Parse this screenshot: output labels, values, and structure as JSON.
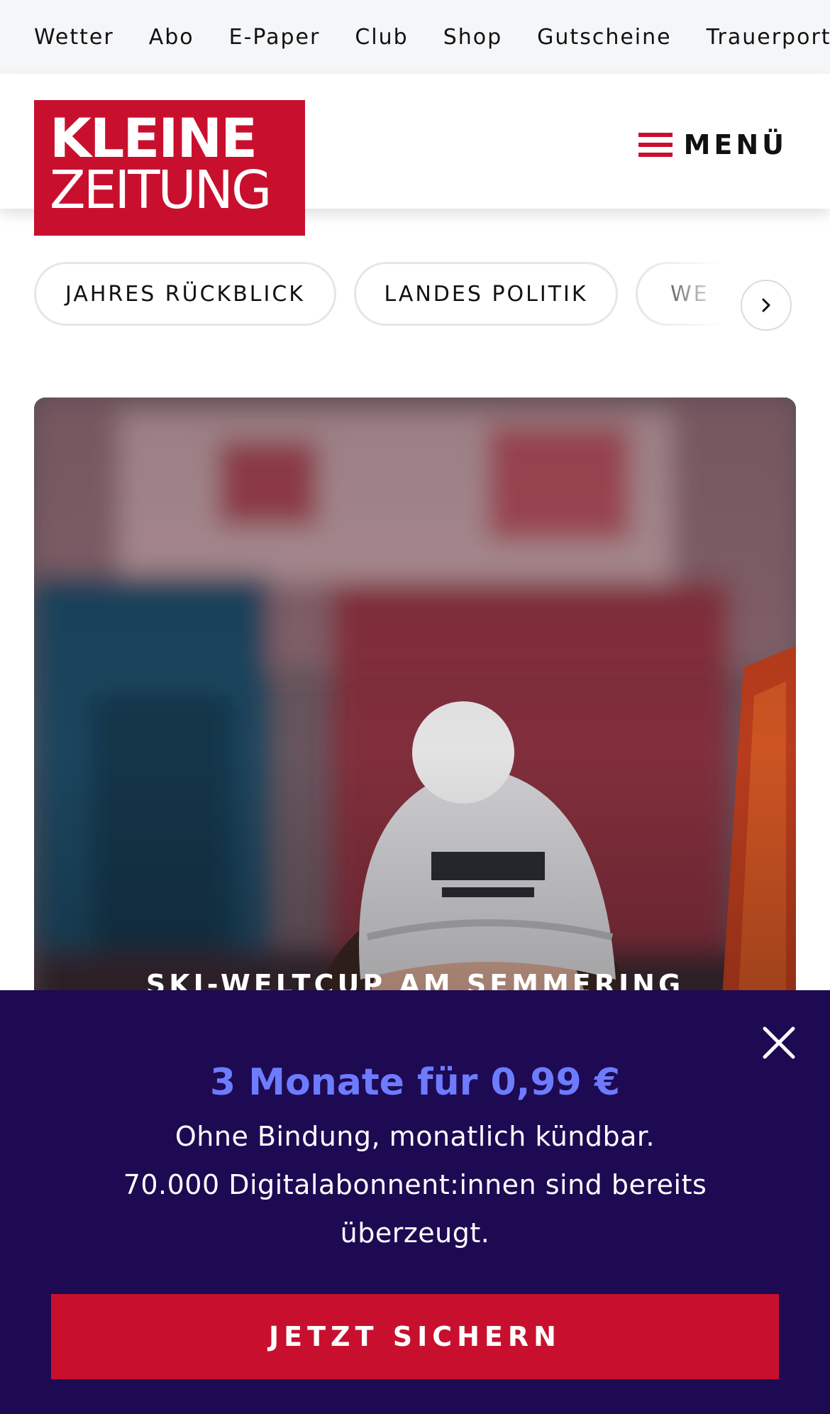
{
  "utility_nav": {
    "items": [
      "Wetter",
      "Abo",
      "E-Paper",
      "Club",
      "Shop",
      "Gutscheine",
      "Trauerportal"
    ]
  },
  "header": {
    "logo_line1": "KLEINE",
    "logo_line2": "ZEITUNG",
    "menu_label": "MENÜ",
    "brand_color": "#c8102e"
  },
  "topics": {
    "items": [
      "JAHRES RÜCKBLICK",
      "LANDES POLITIK",
      "WE"
    ],
    "next_icon": "chevron-right-icon"
  },
  "hero": {
    "kicker": "SKI-WELTCUP AM SEMMERING"
  },
  "promo": {
    "headline": "3 Monate für 0,99 €",
    "line1": "Ohne Bindung, monatlich kündbar.",
    "line2": "70.000 Digitalabonnent:innen sind bereits überzeugt.",
    "cta_label": "JETZT SICHERN",
    "close_icon": "close-icon",
    "background_color": "#1e0a52",
    "headline_color": "#6d7cff"
  }
}
